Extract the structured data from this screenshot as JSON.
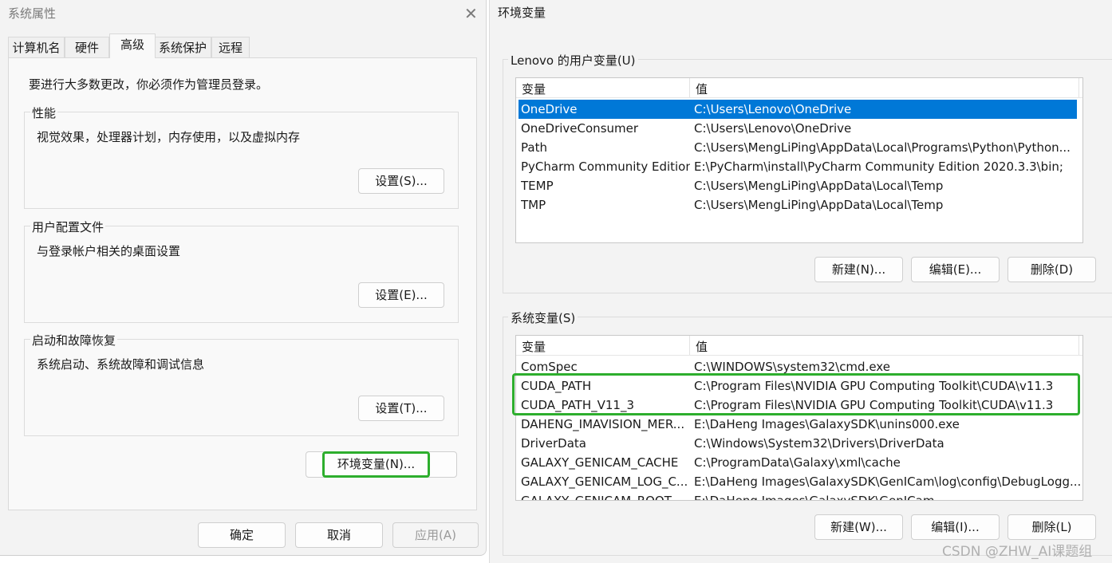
{
  "left_dialog": {
    "title": "系统属性",
    "tabs": [
      {
        "label": "计算机名"
      },
      {
        "label": "硬件"
      },
      {
        "label": "高级"
      },
      {
        "label": "系统保护"
      },
      {
        "label": "远程"
      }
    ],
    "admin_note": "要进行大多数更改，你必须作为管理员登录。",
    "groups": [
      {
        "title": "性能",
        "desc": "视觉效果，处理器计划，内存使用，以及虚拟内存",
        "button": "设置(S)..."
      },
      {
        "title": "用户配置文件",
        "desc": "与登录帐户相关的桌面设置",
        "button": "设置(E)..."
      },
      {
        "title": "启动和故障恢复",
        "desc": "系统启动、系统故障和调试信息",
        "button": "设置(T)..."
      }
    ],
    "env_button": "环境变量(N)...",
    "ok": "确定",
    "cancel": "取消",
    "apply": "应用(A)"
  },
  "right_dialog": {
    "title": "环境变量",
    "user_group": "Lenovo 的用户变量(U)",
    "user_columns": [
      "变量",
      "值"
    ],
    "user_vars": [
      {
        "name": "OneDrive",
        "value": "C:\\Users\\Lenovo\\OneDrive"
      },
      {
        "name": "OneDriveConsumer",
        "value": "C:\\Users\\Lenovo\\OneDrive"
      },
      {
        "name": "Path",
        "value": "C:\\Users\\MengLiPing\\AppData\\Local\\Programs\\Python\\Python..."
      },
      {
        "name": "PyCharm Community Edition",
        "value": "E:\\PyCharm\\install\\PyCharm Community Edition 2020.3.3\\bin;"
      },
      {
        "name": "TEMP",
        "value": "C:\\Users\\MengLiPing\\AppData\\Local\\Temp"
      },
      {
        "name": "TMP",
        "value": "C:\\Users\\MengLiPing\\AppData\\Local\\Temp"
      }
    ],
    "user_buttons": {
      "new": "新建(N)...",
      "edit": "编辑(E)...",
      "delete": "删除(D)"
    },
    "sys_group": "系统变量(S)",
    "sys_columns": [
      "变量",
      "值"
    ],
    "sys_vars": [
      {
        "name": "ComSpec",
        "value": "C:\\WINDOWS\\system32\\cmd.exe"
      },
      {
        "name": "CUDA_PATH",
        "value": "C:\\Program Files\\NVIDIA GPU Computing Toolkit\\CUDA\\v11.3"
      },
      {
        "name": "CUDA_PATH_V11_3",
        "value": "C:\\Program Files\\NVIDIA GPU Computing Toolkit\\CUDA\\v11.3"
      },
      {
        "name": "DAHENG_IMAVISION_MER...",
        "value": "E:\\DaHeng Images\\GalaxySDK\\unins000.exe"
      },
      {
        "name": "DriverData",
        "value": "C:\\Windows\\System32\\Drivers\\DriverData"
      },
      {
        "name": "GALAXY_GENICAM_CACHE",
        "value": "C:\\ProgramData\\Galaxy\\xml\\cache"
      },
      {
        "name": "GALAXY_GENICAM_LOG_C...",
        "value": "E:\\DaHeng Images\\GalaxySDK\\GenICam\\log\\config\\DebugLogg..."
      },
      {
        "name": "GALAXY_GENICAM_ROOT",
        "value": "E:\\DaHeng Images\\GalaxySDK\\GenICam"
      }
    ],
    "sys_buttons": {
      "new": "新建(W)...",
      "edit": "编辑(I)...",
      "delete": "删除(L)"
    }
  },
  "watermark": "CSDN @ZHW_AI课题组",
  "colors": {
    "selection": "#0078d7",
    "highlight_box": "#2dae2d"
  }
}
